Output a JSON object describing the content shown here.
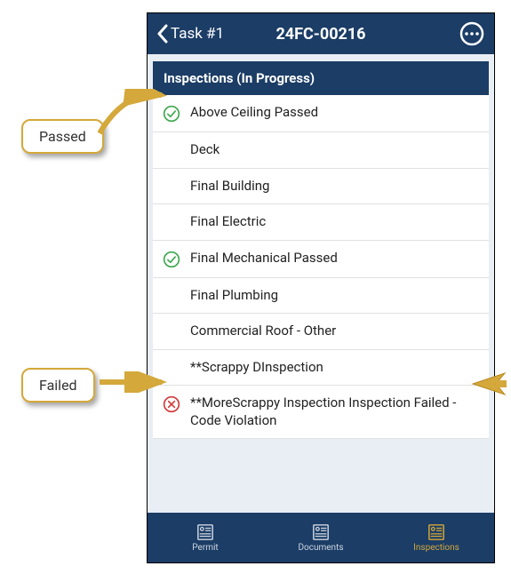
{
  "header": {
    "back_label": "Task #1",
    "title": "24FC-00216"
  },
  "section": {
    "title": "Inspections (In Progress)"
  },
  "rows": [
    {
      "status": "passed",
      "label": "Above Ceiling Passed"
    },
    {
      "status": "none",
      "label": "Deck"
    },
    {
      "status": "none",
      "label": "Final Building"
    },
    {
      "status": "none",
      "label": "Final Electric"
    },
    {
      "status": "passed",
      "label": "Final Mechanical Passed"
    },
    {
      "status": "none",
      "label": "Final  Plumbing"
    },
    {
      "status": "none",
      "label": "Commercial Roof - Other"
    },
    {
      "status": "none",
      "label": "**Scrappy DInspection"
    },
    {
      "status": "failed",
      "label": "**MoreScrappy Inspection Inspection Failed - Code Violation"
    }
  ],
  "tabs": {
    "permit": "Permit",
    "documents": "Documents",
    "inspections": "Inspections",
    "active": "inspections"
  },
  "callouts": {
    "passed": "Passed",
    "failed": "Failed"
  },
  "colors": {
    "brand": "#1b3d66",
    "accent": "#d4a83a",
    "pass": "#3fa84f",
    "fail": "#d23b3b"
  }
}
